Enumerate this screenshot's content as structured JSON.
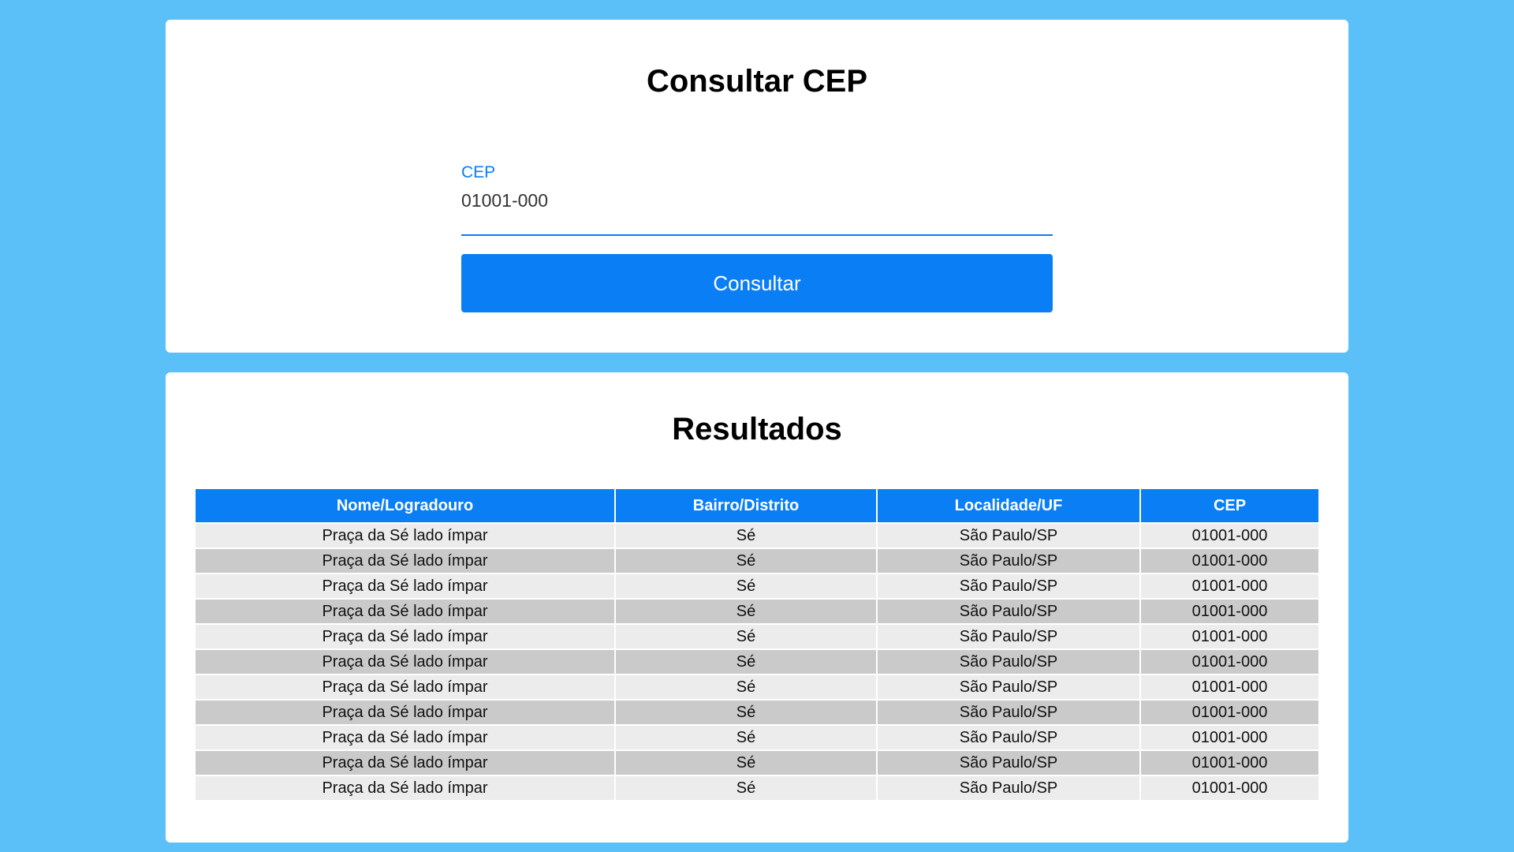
{
  "search": {
    "title": "Consultar CEP",
    "cep_label": "CEP",
    "cep_value": "01001-000",
    "submit_label": "Consultar"
  },
  "results": {
    "title": "Resultados",
    "columns": [
      "Nome/Logradouro",
      "Bairro/Distrito",
      "Localidade/UF",
      "CEP"
    ],
    "rows": [
      [
        "Praça da Sé lado ímpar",
        "Sé",
        "São Paulo/SP",
        "01001-000"
      ],
      [
        "Praça da Sé lado ímpar",
        "Sé",
        "São Paulo/SP",
        "01001-000"
      ],
      [
        "Praça da Sé lado ímpar",
        "Sé",
        "São Paulo/SP",
        "01001-000"
      ],
      [
        "Praça da Sé lado ímpar",
        "Sé",
        "São Paulo/SP",
        "01001-000"
      ],
      [
        "Praça da Sé lado ímpar",
        "Sé",
        "São Paulo/SP",
        "01001-000"
      ],
      [
        "Praça da Sé lado ímpar",
        "Sé",
        "São Paulo/SP",
        "01001-000"
      ],
      [
        "Praça da Sé lado ímpar",
        "Sé",
        "São Paulo/SP",
        "01001-000"
      ],
      [
        "Praça da Sé lado ímpar",
        "Sé",
        "São Paulo/SP",
        "01001-000"
      ],
      [
        "Praça da Sé lado ímpar",
        "Sé",
        "São Paulo/SP",
        "01001-000"
      ],
      [
        "Praça da Sé lado ímpar",
        "Sé",
        "São Paulo/SP",
        "01001-000"
      ],
      [
        "Praça da Sé lado ímpar",
        "Sé",
        "São Paulo/SP",
        "01001-000"
      ]
    ]
  },
  "colors": {
    "page_background": "#5bc0f8",
    "accent": "#0a7ef5",
    "row_light": "#ececec",
    "row_dark": "#cacaca"
  }
}
